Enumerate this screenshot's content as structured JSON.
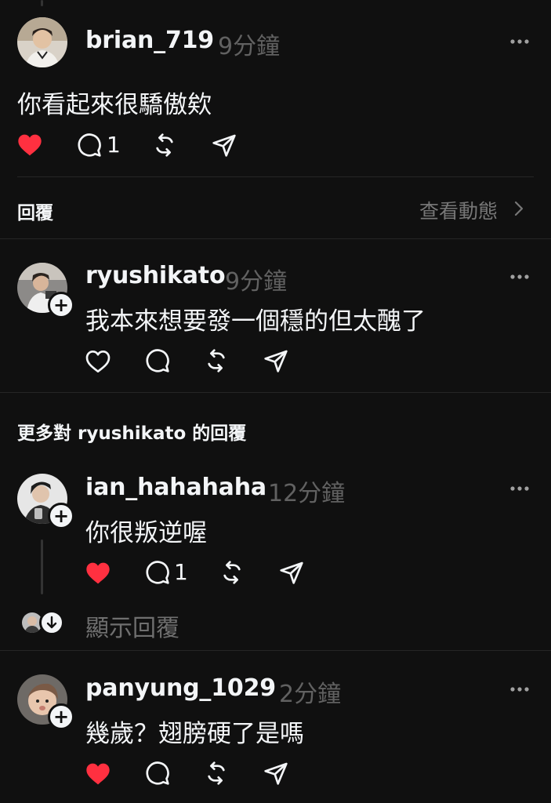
{
  "colors": {
    "background": "#101010",
    "text": "#f3f5f7",
    "muted": "#616161",
    "like_red": "#ff3040",
    "divider": "#262626"
  },
  "main_post": {
    "username": "brian_719",
    "time": "9分鐘",
    "text": "你看起來很驕傲欸",
    "liked": true,
    "reply_count": "1"
  },
  "reply_header": {
    "title": "回覆",
    "view_activity": "查看動態"
  },
  "reply": {
    "username": "ryushikato",
    "time": "9分鐘",
    "text": "我本來想要發一個穩的但太醜了",
    "liked": false
  },
  "more_replies_title": "更多對 ryushikato 的回覆",
  "more_replies": [
    {
      "username": "ian_hahahaha",
      "time": "12分鐘",
      "text": "你很叛逆喔",
      "liked": true,
      "reply_count": "1"
    },
    {
      "username": "panyung_1029",
      "time": "2分鐘",
      "text": "幾歲？翅膀硬了是嗎",
      "liked": true
    }
  ],
  "show_replies_label": "顯示回覆",
  "icons": [
    "heart-icon",
    "comment-icon",
    "repost-icon",
    "share-icon",
    "more-icon",
    "follow-plus-icon",
    "chevron-right-icon",
    "arrow-down-icon"
  ]
}
